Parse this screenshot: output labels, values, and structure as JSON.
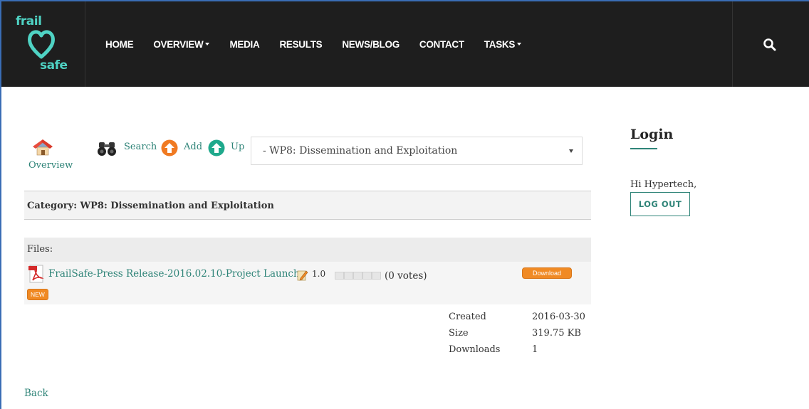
{
  "brand": {
    "logo_top": "frail",
    "logo_bottom": "safe",
    "accent_color": "#4fd3c4",
    "link_color": "#2f8478",
    "orange_color": "#f08a24"
  },
  "nav": {
    "items": [
      {
        "label": "HOME",
        "has_caret": false
      },
      {
        "label": "OVERVIEW",
        "has_caret": true
      },
      {
        "label": "MEDIA",
        "has_caret": false
      },
      {
        "label": "RESULTS",
        "has_caret": false
      },
      {
        "label": "NEWS/BLOG",
        "has_caret": false
      },
      {
        "label": "CONTACT",
        "has_caret": false
      },
      {
        "label": "TASKS",
        "has_caret": true
      }
    ],
    "search_icon": "search-icon"
  },
  "toolbar": {
    "overview_label": "Overview",
    "search_label": "Search",
    "add_label": "Add",
    "up_label": "Up"
  },
  "category_select": {
    "selected": "- WP8: Dissemination and Exploitation"
  },
  "category": {
    "heading": "Category: WP8: Dissemination and Exploitation"
  },
  "files": {
    "heading": "Files:",
    "items": [
      {
        "name": "FrailSafe-Press Release-2016.02.10-Project Launch",
        "version": "1.0",
        "votes": "(0 votes)",
        "rating": 0,
        "badge": "NEW",
        "download_label": "Download"
      }
    ]
  },
  "details": {
    "created_label": "Created",
    "size_label": "Size",
    "downloads_label": "Downloads",
    "created_value": "2016-03-30",
    "size_value": "319.75 KB",
    "downloads_value": "1"
  },
  "back_label": "Back",
  "sidebar": {
    "login_title": "Login",
    "greeting": "Hi Hypertech,",
    "logout_label": "LOG OUT"
  }
}
